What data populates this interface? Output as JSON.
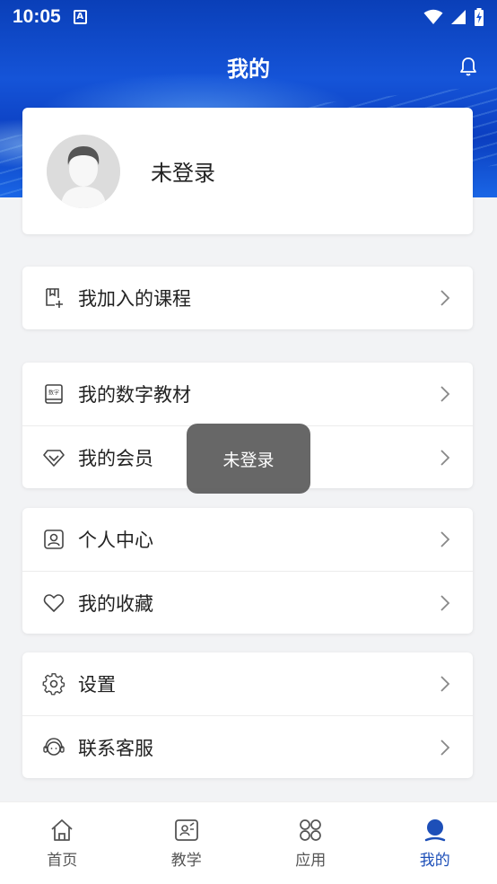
{
  "status_bar": {
    "time": "10:05",
    "a_icon_text": "A"
  },
  "header": {
    "title": "我的"
  },
  "profile": {
    "login_text": "未登录"
  },
  "menu_groups": [
    {
      "items": [
        {
          "label": "我加入的课程",
          "icon": "course-add-icon"
        }
      ]
    },
    {
      "items": [
        {
          "label": "我的数字教材",
          "icon": "digital-book-icon"
        },
        {
          "label": "我的会员",
          "icon": "diamond-icon"
        }
      ]
    },
    {
      "items": [
        {
          "label": "个人中心",
          "icon": "person-badge-icon"
        },
        {
          "label": "我的收藏",
          "icon": "heart-icon"
        }
      ]
    },
    {
      "items": [
        {
          "label": "设置",
          "icon": "gear-icon"
        },
        {
          "label": "联系客服",
          "icon": "headset-icon"
        }
      ]
    }
  ],
  "digital_book_icon_text": "数字",
  "toast": {
    "text": "未登录"
  },
  "bottom_nav": [
    {
      "label": "首页",
      "icon": "home-icon",
      "active": false
    },
    {
      "label": "教学",
      "icon": "teaching-icon",
      "active": false
    },
    {
      "label": "应用",
      "icon": "apps-icon",
      "active": false
    },
    {
      "label": "我的",
      "icon": "user-icon",
      "active": true
    }
  ],
  "colors": {
    "header_blue": "#1554d8",
    "active_nav": "#1d4fb8",
    "background": "#f2f3f5"
  }
}
